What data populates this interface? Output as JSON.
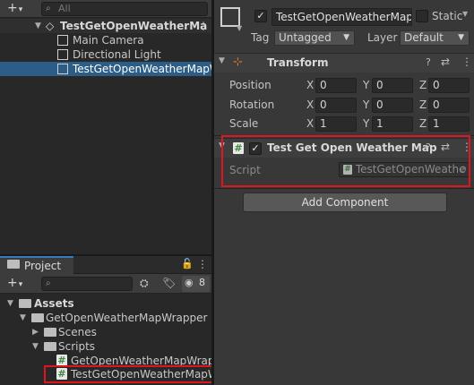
{
  "hierarchy": {
    "add_label": "+",
    "search_placeholder": "All",
    "scene_name": "TestGetOpenWeatherMa",
    "items": [
      {
        "label": "Main Camera"
      },
      {
        "label": "Directional Light"
      },
      {
        "label": "TestGetOpenWeatherMapWr"
      }
    ]
  },
  "project": {
    "tab_label": "Project",
    "add_label": "+",
    "hidden_count": "8",
    "tree": {
      "assets": "Assets",
      "package": "GetOpenWeatherMapWrapper",
      "scenes": "Scenes",
      "scripts": "Scripts",
      "script1": "GetOpenWeatherMapWrapp",
      "script2": "TestGetOpenWeatherMapW"
    }
  },
  "inspector": {
    "object_name": "TestGetOpenWeatherMap",
    "static_label": "Static",
    "tag_label": "Tag",
    "tag_value": "Untagged",
    "layer_label": "Layer",
    "layer_value": "Default",
    "transform": {
      "title": "Transform",
      "position_label": "Position",
      "rotation_label": "Rotation",
      "scale_label": "Scale",
      "x": "X",
      "y": "Y",
      "z": "Z",
      "position": [
        "0",
        "0",
        "0"
      ],
      "rotation": [
        "0",
        "0",
        "0"
      ],
      "scale": [
        "1",
        "1",
        "1"
      ]
    },
    "component": {
      "title": "Test Get Open Weather Map",
      "script_label": "Script",
      "script_value": "TestGetOpenWeathe"
    },
    "add_component_label": "Add Component"
  },
  "colors": {
    "selection": "#2c5d87",
    "highlight_box": "#e0161e",
    "panel_dark": "#282828",
    "panel": "#383838"
  }
}
